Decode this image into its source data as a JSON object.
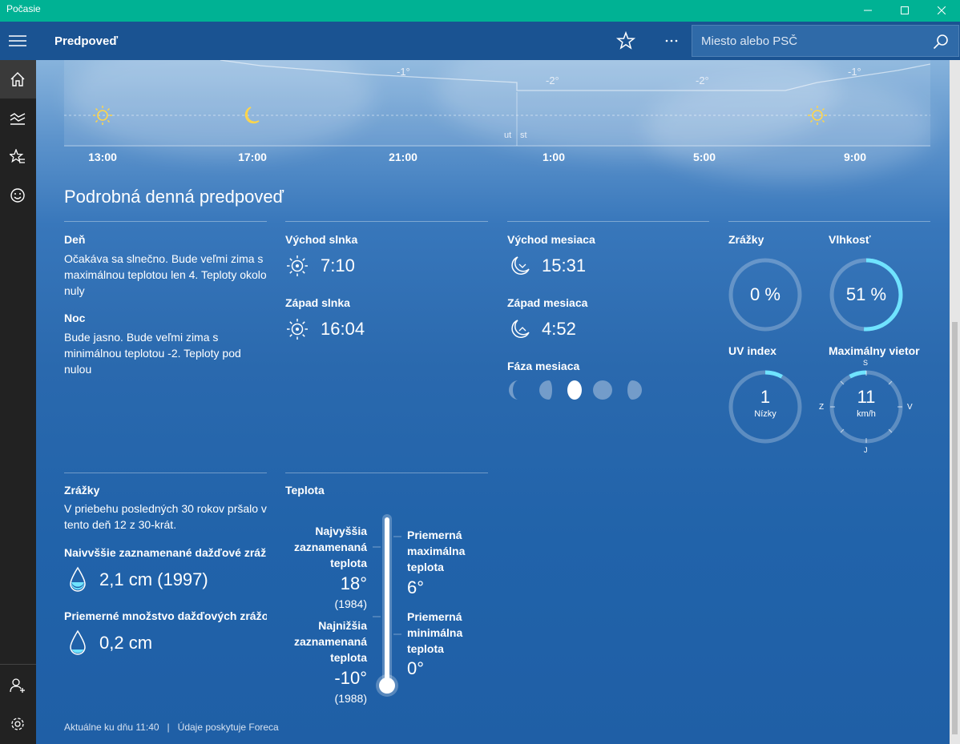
{
  "window": {
    "title": "Počasie"
  },
  "appbar": {
    "title": "Predpoveď",
    "search_placeholder": "Miesto alebo PSČ"
  },
  "hourly": {
    "times": [
      "13:00",
      "17:00",
      "21:00",
      "1:00",
      "5:00",
      "9:00"
    ],
    "temps": [
      "-1°",
      "-2°",
      "-2°",
      "-1°"
    ],
    "day_marks": [
      "ut",
      "st"
    ],
    "icons": [
      "sun-icon",
      "moon-icon",
      "sun-icon"
    ]
  },
  "detail": {
    "heading": "Podrobná denná predpoveď",
    "day_label": "Deň",
    "day_text": "Očakáva sa slnečno. Bude veľmi zima s maximálnou teplotou len 4. Teploty okolo nuly",
    "night_label": "Noc",
    "night_text": "Bude jasno. Bude veľmi zima s minimálnou teplotou -2. Teploty pod nulou",
    "sunrise_label": "Východ slnka",
    "sunrise": "7:10",
    "sunset_label": "Západ slnka",
    "sunset": "16:04",
    "moonrise_label": "Východ mesiaca",
    "moonrise": "15:31",
    "moonset_label": "Západ mesiaca",
    "moonset": "4:52",
    "moonphase_label": "Fáza mesiaca",
    "precip_label": "Zrážky",
    "precip_value": "0 %",
    "precip_fraction": 0,
    "humidity_label": "Vlhkosť",
    "humidity_value": "51 %",
    "humidity_fraction": 0.51,
    "uv_label": "UV index",
    "uv_value": "1",
    "uv_desc": "Nízky",
    "uv_fraction": 0.08,
    "wind_label": "Maximálny vietor",
    "wind_value": "11",
    "wind_unit": "km/h",
    "wind_fraction": 0.14,
    "compass": {
      "n": "S",
      "s": "J",
      "e": "V",
      "w": "Z"
    }
  },
  "history": {
    "precip_label": "Zrážky",
    "precip_text": "V priebehu posledných 30 rokov pršalo v tento deň 12 z 30-krát.",
    "max_rain_label": "Naivvššie zaznamenané dažďové zrážky",
    "max_rain_value": "2,1 cm (1997)",
    "avg_rain_label": "Priemerné množstvo dažďových zrážok",
    "avg_rain_value": "0,2 cm",
    "temp_label": "Teplota",
    "record_high_label": "Najvyššia zaznamenaná teplota",
    "record_high_value": "18°",
    "record_high_year": "(1984)",
    "record_low_label": "Najnižšia zaznamenaná teplota",
    "record_low_value": "-10°",
    "record_low_year": "(1988)",
    "avg_max_label": "Priemerná maximálna teplota",
    "avg_max_value": "6°",
    "avg_min_label": "Priemerná minimálna teplota",
    "avg_min_value": "0°"
  },
  "footer": {
    "text": "Aktuálne ku dňu 11:40   |   Údaje poskytuje Foreca"
  },
  "colors": {
    "accent": "#00b294",
    "gauge": "#6fe3ff"
  }
}
